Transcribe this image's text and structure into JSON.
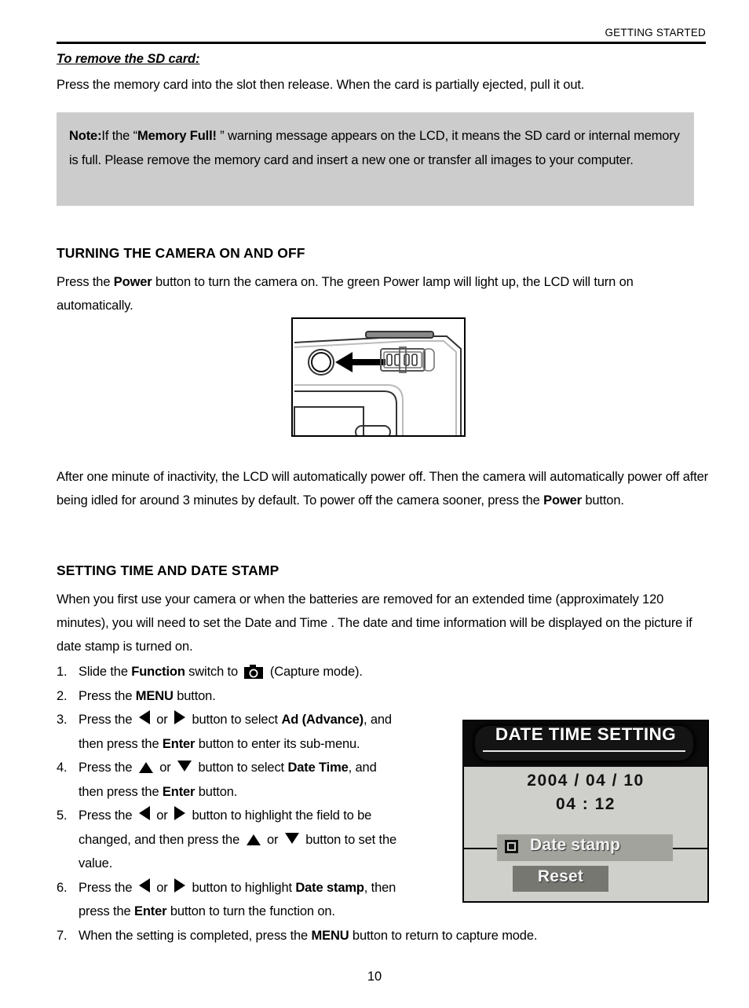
{
  "header": {
    "running_head": "GETTING STARTED"
  },
  "sd_card": {
    "subhead": "To remove the SD card:",
    "body": "Press the memory card into the slot then release. When the card is partially ejected, pull it out."
  },
  "note_box": {
    "label": "Note:",
    "line_start": "If the “",
    "bold_message": "Memory Full!",
    "body": " ” warning message appears on the LCD, it means the SD card or internal memory is full. Please remove the memory card and insert a new one or transfer all images to your computer."
  },
  "turning_on_off": {
    "heading": "TURNING THE CAMERA ON AND OFF",
    "para_before_a": "Press the ",
    "para_before_bold": "Power",
    "para_before_b": " button to turn the camera on. The green Power lamp will light up, the LCD will turn on automatically.",
    "figure_alt": "camera-top-corner-power-button-illustration",
    "para_after_a": "After one minute of  inactivity, the LCD will automatically power off. Then the camera will automatically power off after being idled for around 3 minutes by default. To power off the camera sooner, press the ",
    "para_after_bold": "Power",
    "para_after_b": " button."
  },
  "date_stamp": {
    "heading": "SETTING TIME AND DATE STAMP",
    "intro": "When you first use your camera or when the batteries are removed for an extended time (approximately 120 minutes), you will need to set the Date and Time . The date and time information will be displayed on the picture if date stamp is turned on.",
    "steps": [
      {
        "num": "1.",
        "parts": [
          "Slide the ",
          "Function",
          " switch to ",
          "[camera-icon]",
          " (Capture mode)."
        ]
      },
      {
        "num": "2.",
        "parts": [
          "Press the ",
          "MENU",
          " button."
        ]
      },
      {
        "num": "3.",
        "parts": [
          "Press the ",
          "[left]",
          " or ",
          "[right]",
          " button to select ",
          "Ad (Advance)",
          ", and then press the ",
          "Enter",
          " button to enter its sub-menu."
        ]
      },
      {
        "num": "4.",
        "parts": [
          "Press the ",
          "[up]",
          " or ",
          "[down]",
          " button to select ",
          "Date Time",
          ", and then press the ",
          "Enter",
          " button."
        ]
      },
      {
        "num": "5.",
        "parts": [
          "Press the ",
          "[left]",
          " or ",
          "[right]",
          " button to highlight the field to be changed, and then press the ",
          "[up]",
          " or ",
          "[down]",
          " button to set the value."
        ]
      },
      {
        "num": "6.",
        "parts": [
          "Press the ",
          "[left]",
          " or ",
          "[right]",
          " button to highlight ",
          "Date stamp",
          ", then press the ",
          "Enter",
          " button to turn the function on."
        ]
      },
      {
        "num": "7.",
        "parts": [
          "When the setting is completed, press the ",
          "MENU",
          " button to return to capture mode."
        ]
      }
    ],
    "step1": {
      "a": "Slide the ",
      "b": "Function",
      "c": " switch to ",
      "d": " (Capture mode)."
    },
    "step2": {
      "a": "Press the ",
      "b": "MENU",
      "c": " button."
    },
    "step3": {
      "a": "Press the ",
      "b": " or ",
      "c": " button to select ",
      "d": "Ad (Advance)",
      "e": ", and",
      "f": "then press the ",
      "g": "Enter",
      "h": " button to enter its sub-menu."
    },
    "step4": {
      "a": "Press the ",
      "b": " or ",
      "c": " button to select ",
      "d": "Date Time",
      "e": ", and",
      "f": "then press the ",
      "g": "Enter",
      "h": " button."
    },
    "step5": {
      "a": "Press the ",
      "b": " or ",
      "c": " button to highlight the field to be",
      "d": "changed, and then press the ",
      "e": " or ",
      "f": " button to set the",
      "g": "value."
    },
    "step6": {
      "a": "Press the ",
      "b": " or ",
      "c": " button to highlight ",
      "d": "Date stamp",
      "e": ", then",
      "f": "press the ",
      "g": "Enter",
      "h": " button to turn the function on."
    },
    "step7": {
      "a": "When the setting is completed, press the ",
      "b": "MENU",
      "c": " button to return to capture mode."
    }
  },
  "lcd_screen": {
    "title": "DATE TIME SETTING",
    "date": "2004 / 04 / 10",
    "time": "04 : 12",
    "date_stamp_label": "Date stamp",
    "reset_label": "Reset"
  },
  "footer": {
    "page_number": "10"
  },
  "colors": {
    "note_box_bg": "#cccccc",
    "lcd_bg": "#cfcfcb",
    "lcd_banner": "#0b0b0b",
    "lcd_highlight": "#a3a39d",
    "lcd_button": "#777772",
    "rule": "#000000"
  }
}
